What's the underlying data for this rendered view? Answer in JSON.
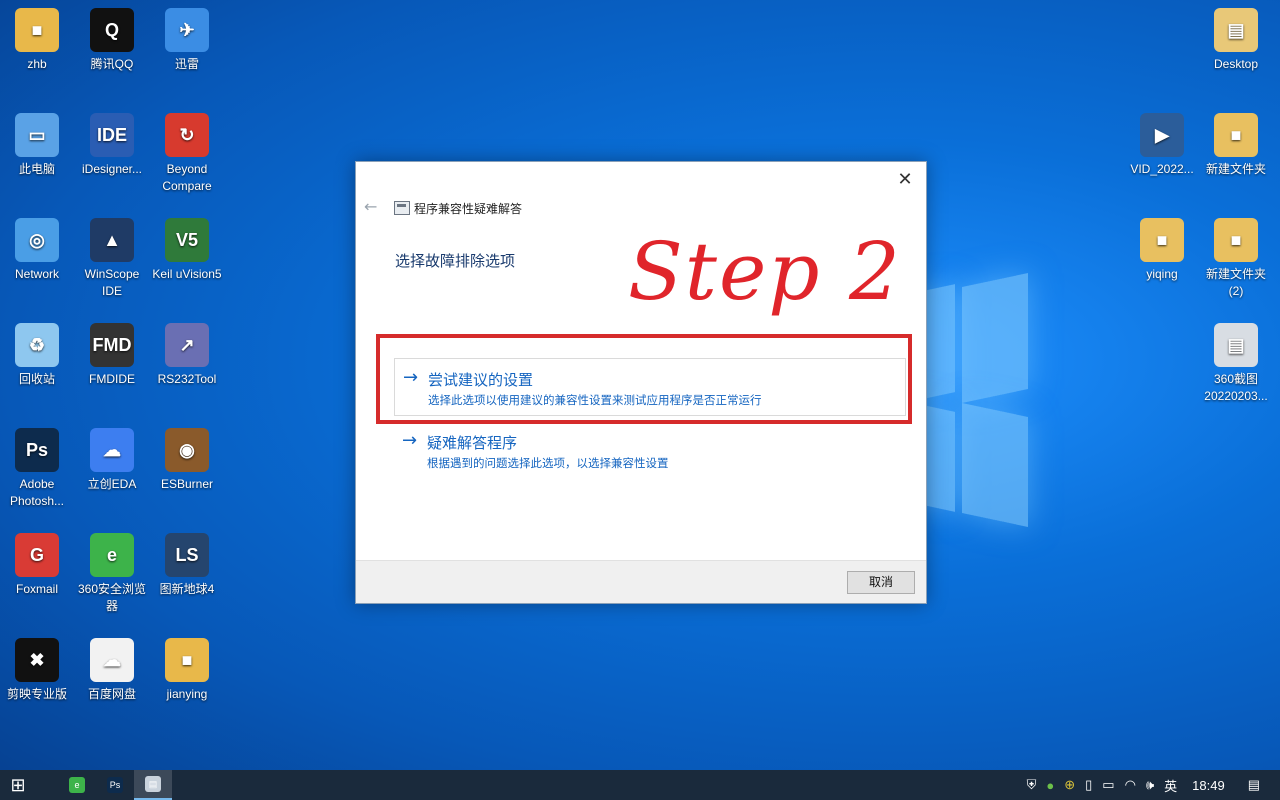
{
  "desktop": {
    "icons_left": [
      {
        "label": "zhb",
        "color": "#e8b84a",
        "glyph": "■"
      },
      {
        "label": "腾讯QQ",
        "color": "#111111",
        "glyph": "Q"
      },
      {
        "label": "迅雷",
        "color": "#3b8de4",
        "glyph": "✈"
      },
      {
        "label": "此电脑",
        "color": "#5aa2e6",
        "glyph": "▭"
      },
      {
        "label": "iDesigner...",
        "color": "#2a5db3",
        "glyph": "IDE"
      },
      {
        "label": "Beyond Compare",
        "color": "#d73a2e",
        "glyph": "↻"
      },
      {
        "label": "Network",
        "color": "#4a9ee6",
        "glyph": "◎"
      },
      {
        "label": "WinScope IDE",
        "color": "#1f3b66",
        "glyph": "▲"
      },
      {
        "label": "Keil uVision5",
        "color": "#2f7a3a",
        "glyph": "V5"
      },
      {
        "label": "回收站",
        "color": "#8ec7ef",
        "glyph": "♻"
      },
      {
        "label": "FMDIDE",
        "color": "#333333",
        "glyph": "FMD"
      },
      {
        "label": "RS232Tool",
        "color": "#6a6fb3",
        "glyph": "↗"
      },
      {
        "label": "Adobe Photosh...",
        "color": "#0d2b4d",
        "glyph": "Ps"
      },
      {
        "label": "立创EDA",
        "color": "#3d7ef0",
        "glyph": "☁"
      },
      {
        "label": "ESBurner",
        "color": "#8a5a2b",
        "glyph": "◉"
      },
      {
        "label": "Foxmail",
        "color": "#d93b35",
        "glyph": "G"
      },
      {
        "label": "360安全浏览器",
        "color": "#3db34a",
        "glyph": "e"
      },
      {
        "label": "图新地球4",
        "color": "#25456e",
        "glyph": "LS"
      },
      {
        "label": "剪映专业版",
        "color": "#111111",
        "glyph": "✖"
      },
      {
        "label": "百度网盘",
        "color": "#f2f2f2",
        "glyph": "☁"
      },
      {
        "label": "jianying",
        "color": "#e8b84a",
        "glyph": "■"
      }
    ],
    "icons_right": [
      {
        "label": "Desktop",
        "color": "#e8c878",
        "glyph": "▤"
      },
      {
        "label": "VID_2022...",
        "color": "#2b5d9a",
        "glyph": "▶"
      },
      {
        "label": "新建文件夹",
        "color": "#e8c060",
        "glyph": "■"
      },
      {
        "label": "yiqing",
        "color": "#e8c060",
        "glyph": "■"
      },
      {
        "label": "新建文件夹 (2)",
        "color": "#e8c060",
        "glyph": "■"
      },
      {
        "label": "360截图 20220203...",
        "color": "#d8dde3",
        "glyph": "▤"
      }
    ]
  },
  "dialog": {
    "title": "程序兼容性疑难解答",
    "heading": "选择故障排除选项",
    "close_glyph": "✕",
    "back_glyph": "←",
    "options": [
      {
        "title": "尝试建议的设置",
        "desc": "选择此选项以使用建议的兼容性设置来测试应用程序是否正常运行",
        "arrow": "→"
      },
      {
        "title": "疑难解答程序",
        "desc": "根据遇到的问题选择此选项，以选择兼容性设置",
        "arrow": "→"
      }
    ],
    "cancel_label": "取消"
  },
  "annotation": {
    "step_text": "Step 2",
    "color": "#e0252b"
  },
  "taskbar": {
    "start_glyph": "⊞",
    "apps": [
      {
        "name": "360-browser",
        "color": "#3db34a",
        "glyph": "e"
      },
      {
        "name": "photoshop",
        "color": "#0d2b4d",
        "glyph": "Ps"
      },
      {
        "name": "compat-troubleshooter",
        "color": "#c9d2dc",
        "glyph": "▤"
      }
    ],
    "tray": {
      "ime": "英",
      "time": "18:49"
    }
  }
}
